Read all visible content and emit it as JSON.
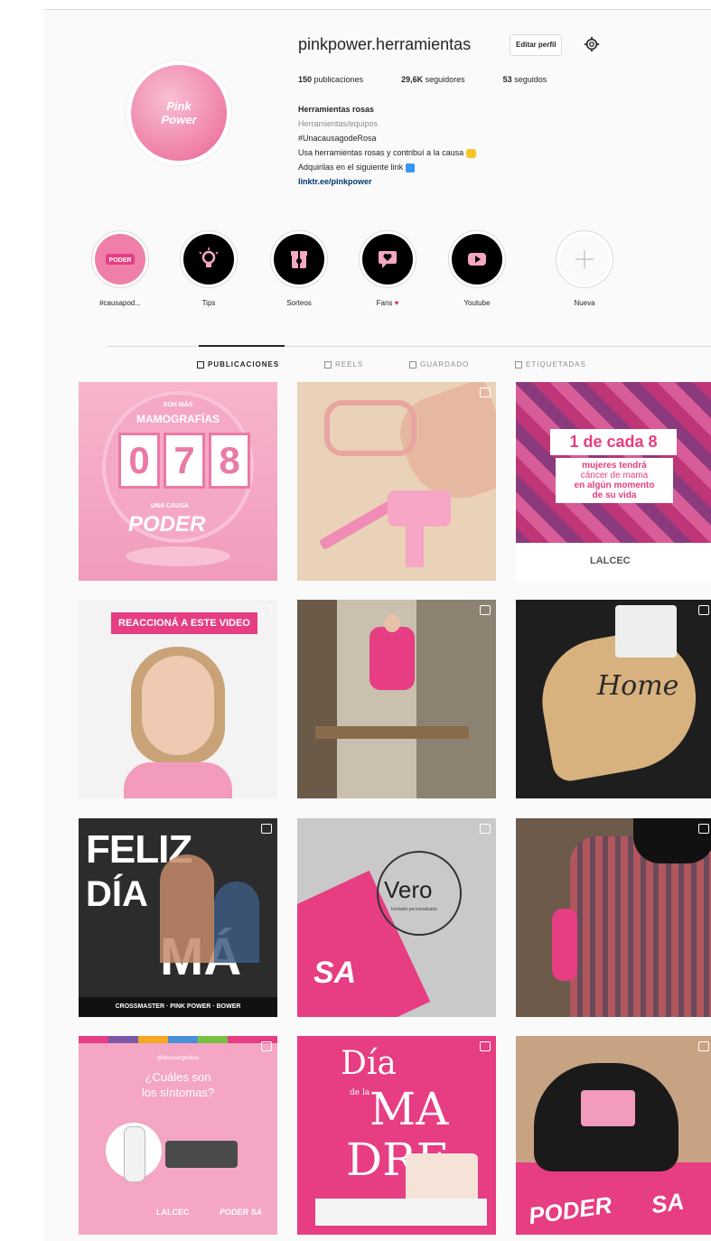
{
  "profile": {
    "username": "pinkpower.herramientas",
    "edit_label": "Editar perfil",
    "avatar_text_1": "Pink",
    "avatar_text_2": "Power",
    "stats": {
      "posts": "150",
      "posts_label": "publicaciones",
      "followers": "29,6K",
      "followers_label": "seguidores",
      "following": "53",
      "following_label": "seguidos"
    },
    "bio": {
      "name": "Herramientas rosas",
      "category": "Herramientas/equipos",
      "line1": "#UnacausagodeRosa",
      "line2": "Usa herramientas rosas y contribuí a la causa",
      "line3": "Adquirilas en el siguiente link",
      "link": "linktr.ee/pinkpower"
    }
  },
  "highlights": [
    {
      "label": "#causapod...",
      "icon": "pink-power-logo-icon"
    },
    {
      "label": "Tips",
      "icon": "lightbulb-icon"
    },
    {
      "label": "Sorteos",
      "icon": "gift-icon"
    },
    {
      "label": "Fans",
      "icon": "heart-chat-icon"
    },
    {
      "label": "Youtube",
      "icon": "play-icon"
    },
    {
      "label": "Nueva",
      "icon": "plus-icon"
    }
  ],
  "tabs": [
    {
      "label": "PUBLICACIONES"
    },
    {
      "label": "REELS"
    },
    {
      "label": "GUARDADO"
    },
    {
      "label": "ETIQUETADAS"
    }
  ],
  "posts": {
    "p1": {
      "top": "SON MÁS",
      "mid": "MAMOGRAFÍAS",
      "count": [
        "0",
        "7",
        "8"
      ],
      "brand": "PODER",
      "small": "UNA CAUSA"
    },
    "p3": {
      "big": "1 de cada 8",
      "l1": "mujeres",
      "l1b": "tendrá",
      "l2": "cáncer de mama",
      "l3": "en algún momento",
      "l4": "de su vida",
      "org": "LALCEC"
    },
    "p4": {
      "banner": "REACCIONÁ A ESTE VIDEO"
    },
    "p6": {
      "text": "Home"
    },
    "p7": {
      "l1": "FELIZ",
      "l2": "DÍA",
      "l3": "MÁ",
      "brands": "CROSSMASTER · PINK POWER · BOWER"
    },
    "p8": {
      "text": "Vero",
      "sub": "bordado personalizado",
      "brand": "SA"
    },
    "p10": {
      "top": "@lalcecargentina",
      "q1": "¿Cuáles son",
      "q2": "los síntomas?",
      "org": "LALCEC",
      "brand": "PODER SA"
    },
    "p11": {
      "l1": "Día",
      "l2": "de la",
      "l3": "MA",
      "l4": "DRE"
    },
    "p12": {
      "brand": "PODER",
      "brand2": "SA"
    }
  },
  "colors": {
    "pink": "#e63d83",
    "lightpink": "#f4a6c4",
    "black": "#000000"
  }
}
